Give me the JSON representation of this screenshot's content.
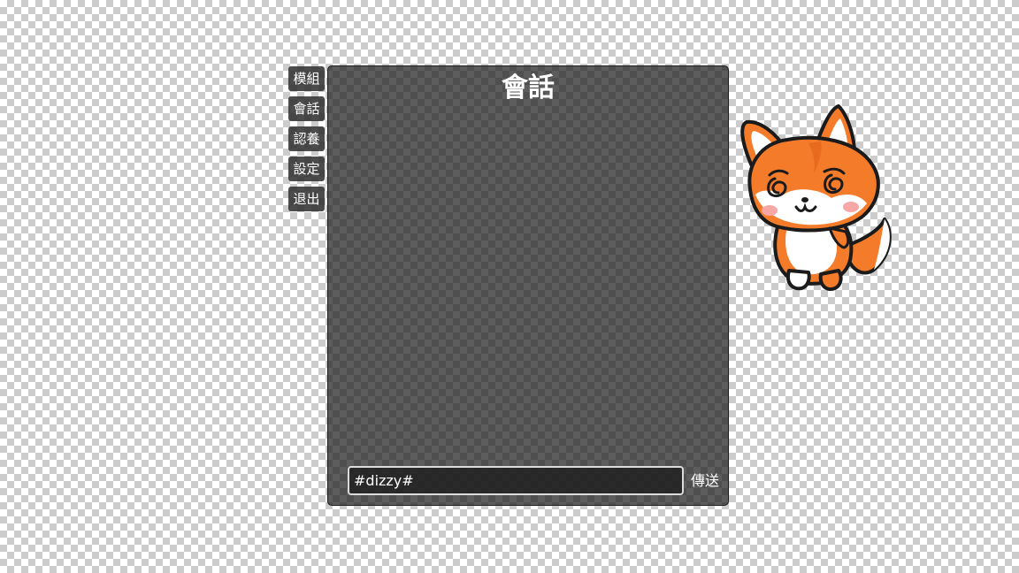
{
  "menu": {
    "items": [
      {
        "label": "模組"
      },
      {
        "label": "會話"
      },
      {
        "label": "認養"
      },
      {
        "label": "設定"
      },
      {
        "label": "退出"
      }
    ]
  },
  "chat": {
    "title": "會話",
    "input_value": "#dizzy#",
    "send_label": "傳送"
  },
  "mascot": {
    "icon": "fox-mascot-dizzy",
    "colors": {
      "fur": "#f47b2a",
      "outline": "#1b1b1b",
      "belly": "#ffffff",
      "blush": "#f6a7a6"
    }
  }
}
